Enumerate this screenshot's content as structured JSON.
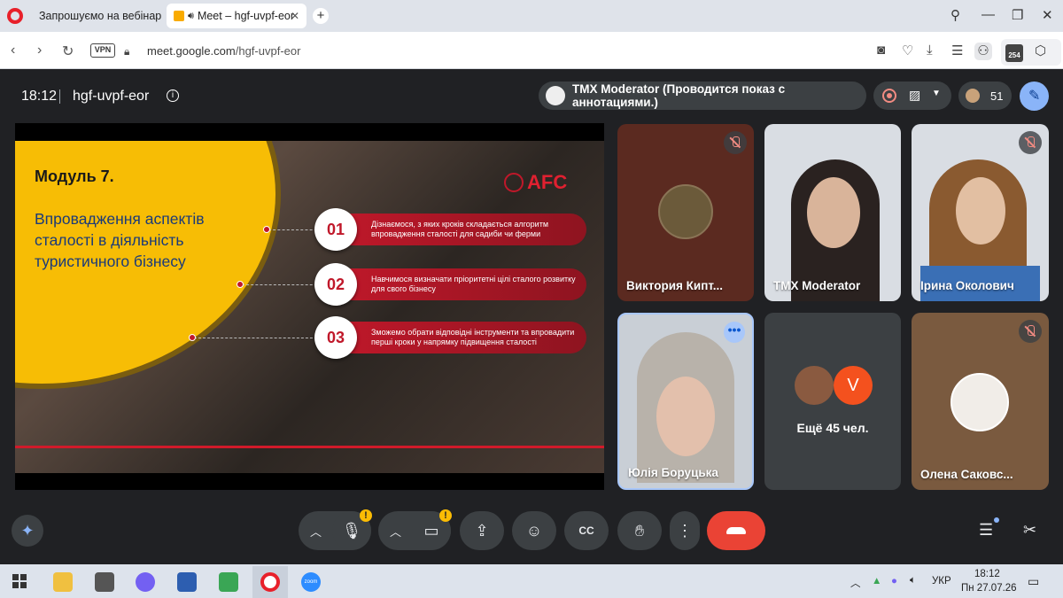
{
  "browser": {
    "tabs": [
      {
        "label": "Запрошуємо на вебінар",
        "active": false
      },
      {
        "label": "Meet – hgf-uvpf-eor",
        "active": true
      }
    ],
    "address": {
      "vpn_label": "VPN",
      "domain": "meet.google.com",
      "path": "/hgf-uvpf-eor"
    },
    "extension_badge": "254"
  },
  "meet": {
    "time": "18:12",
    "meeting_code": "hgf-uvpf-eor",
    "presenter_label": "TMX Moderator (Проводится показ с аннотациями.)",
    "participant_count": "51"
  },
  "slide": {
    "brand": "AFC",
    "title": "Модуль 7.",
    "subtitle": "Впровадження аспектів сталості в діяльність туристичного бізнесу",
    "steps": [
      {
        "number": "01",
        "text": "Дізнаємося, з яких кроків складається алгоритм впровадження сталості для садиби чи ферми"
      },
      {
        "number": "02",
        "text": "Навчимося визначати пріоритетні цілі сталого розвитку для свого бізнесу"
      },
      {
        "number": "03",
        "text": "Зможемо обрати відповідні інструменти та впровадити перші кроки у напрямку підвищення сталості"
      }
    ]
  },
  "participants": [
    {
      "name": "Виктория Кипт...",
      "muted": true
    },
    {
      "name": "TMX Moderator",
      "muted": false
    },
    {
      "name": "Ірина Околович",
      "muted": true
    },
    {
      "name": "Юлія Боруцька",
      "muted": false
    },
    {
      "name": "Ещё 45 чел.",
      "avatar_letter": "V"
    },
    {
      "name": "Олена Саковс...",
      "muted": true
    }
  ],
  "taskbar": {
    "language": "УКР",
    "clock_time": "18:12",
    "clock_date": "Пн 27.07.26"
  },
  "colors": {
    "meet_bg": "#202124",
    "end_call": "#ea4335",
    "slide_red": "#c0182a",
    "slide_yellow": "#f7bd05"
  }
}
